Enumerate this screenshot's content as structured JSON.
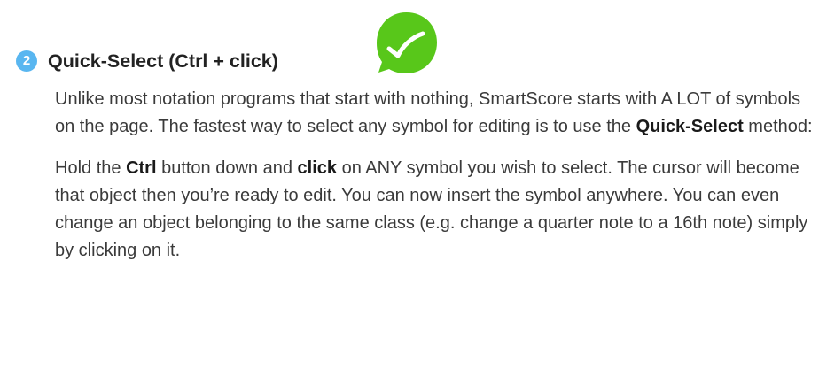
{
  "step": {
    "number": "2",
    "title": "Quick-Select (Ctrl + click)"
  },
  "icons": {
    "badge": "checkmark-icon",
    "badge_color": "#58c71a"
  },
  "paragraph1": {
    "text1": "Unlike most notation programs that start with nothing, SmartScore starts with A LOT of symbols on the page. The fastest way to select any symbol for editing is to use the ",
    "bold1": "Quick-Select",
    "text2": " method:"
  },
  "paragraph2": {
    "text1": "Hold the ",
    "bold1": "Ctrl",
    "text2": " button down and ",
    "bold2": "click",
    "text3": " on ANY symbol you wish to select. The cursor will become that object then you’re ready to edit. You can now insert the symbol anywhere. You can even change an object belonging to the same class (e.g. change a quarter note to a 16th note) simply by clicking on it."
  }
}
